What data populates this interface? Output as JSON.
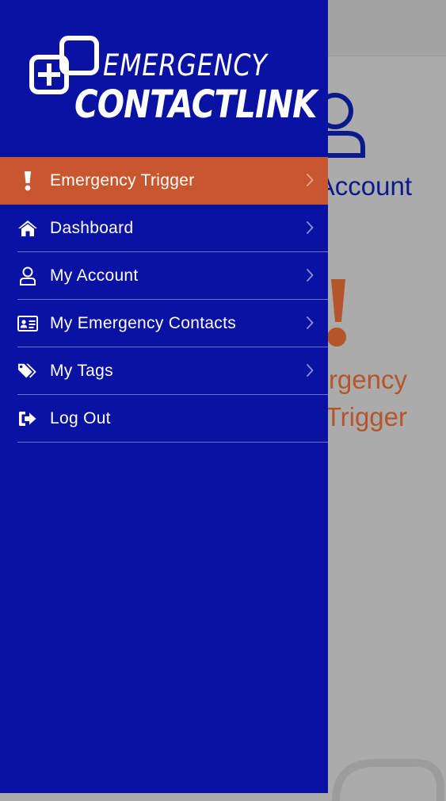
{
  "app": {
    "logo_line1": "EMERGENCY",
    "logo_line2": "CONTACTLINK"
  },
  "background": {
    "account_label": "My Account",
    "emergency_label_line1": "Emergency",
    "emergency_label_line2": "Trigger"
  },
  "menu": {
    "items": [
      {
        "label": "Emergency Trigger",
        "icon": "exclamation-icon",
        "active": true,
        "chevron": true
      },
      {
        "label": "Dashboard",
        "icon": "home-icon",
        "active": false,
        "chevron": true
      },
      {
        "label": "My Account",
        "icon": "user-icon",
        "active": false,
        "chevron": true
      },
      {
        "label": "My Emergency Contacts",
        "icon": "id-card-icon",
        "active": false,
        "chevron": true
      },
      {
        "label": "My Tags",
        "icon": "tags-icon",
        "active": false,
        "chevron": true
      },
      {
        "label": "Log Out",
        "icon": "sign-out-icon",
        "active": false,
        "chevron": false
      }
    ]
  },
  "colors": {
    "drawer_bg": "#0a12a3",
    "active_item": "#c8562e",
    "divider": "#6b74c9",
    "overlay": "#ababab",
    "bg_account_text": "#0a1a8c",
    "bg_emergency_text": "#b4552c"
  }
}
